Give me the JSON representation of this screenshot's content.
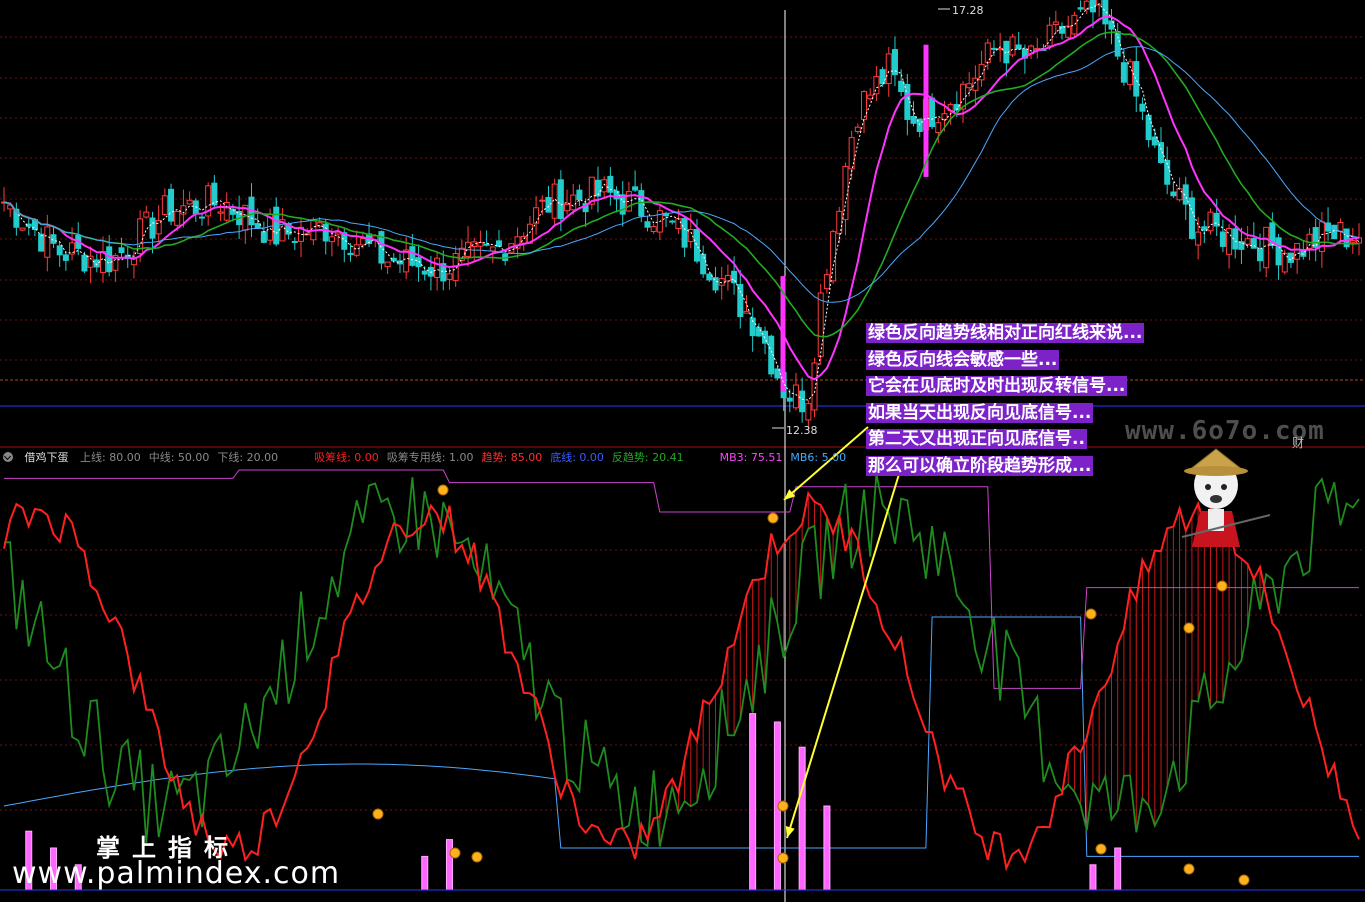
{
  "price": {
    "high_label": "17.28",
    "low_label": "12.38"
  },
  "indicator": {
    "name": "借鸡下蛋",
    "params": [
      {
        "text": "上线: 80.00",
        "color": "#8a8a8a"
      },
      {
        "text": "中线: 50.00",
        "color": "#8a8a8a"
      },
      {
        "text": "下线: 20.00",
        "color": "#8a8a8a"
      },
      {
        "text": "吸筹线: 0.00",
        "color": "#ff2020"
      },
      {
        "text": "吸筹专用线: 1.00",
        "color": "#8a8a8a"
      },
      {
        "text": "趋势: 85.00",
        "color": "#ff3030"
      },
      {
        "text": "底线: 0.00",
        "color": "#3a5cff"
      },
      {
        "text": "反趋势: 20.41",
        "color": "#22aa22"
      },
      {
        "text": "MB3: 75.51",
        "color": "#ff44ff"
      },
      {
        "text": "MB6: 5.00",
        "color": "#44aaff"
      }
    ]
  },
  "annotation": {
    "lines": [
      "绿色反向趋势线相对正向红线来说...",
      "绿色反向线会敏感一些...",
      "它会在见底时及时出现反转信号...",
      "如果当天出现反向见底信号...",
      "第二天又出现正向见底信号..",
      "那么可以确立阶段趋势形成..."
    ]
  },
  "watermarks": {
    "site": "www.6o7o.com",
    "cai": "财",
    "brand_cn": "掌上指标",
    "brand_url": "www.palmindex.com"
  },
  "colors": {
    "up": "#ff3c3c",
    "down": "#22cccc",
    "ma_white": "#ffffff",
    "ma_magenta": "#ff33ff",
    "ma_green": "#22aa22",
    "ma_blue": "#4aa8ff",
    "trend_red": "#ff2020",
    "anti_trend_green": "#1e8c1e",
    "annotation_bg": "#7d22c8",
    "arrow": "#ffff33"
  }
}
